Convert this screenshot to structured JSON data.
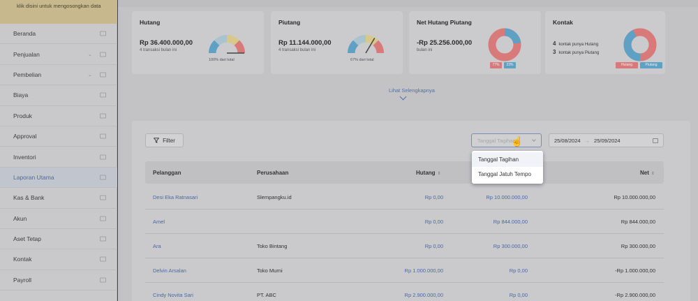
{
  "sidebar": {
    "notice": "klik disini untuk mengosongkan data",
    "items": [
      {
        "label": "Beranda",
        "chev": false
      },
      {
        "label": "Penjualan",
        "chev": true
      },
      {
        "label": "Pembelian",
        "chev": true
      },
      {
        "label": "Biaya",
        "chev": false
      },
      {
        "label": "Produk",
        "chev": false
      },
      {
        "label": "Approval",
        "chev": false
      },
      {
        "label": "Inventori",
        "chev": false
      },
      {
        "label": "Laporan Utama",
        "chev": false,
        "active": true
      },
      {
        "label": "Kas & Bank",
        "chev": false
      },
      {
        "label": "Akun",
        "chev": false
      },
      {
        "label": "Aset Tetap",
        "chev": false
      },
      {
        "label": "Kontak",
        "chev": false
      },
      {
        "label": "Payroll",
        "chev": false
      }
    ]
  },
  "cards": {
    "hutang": {
      "title": "Hutang",
      "amount": "Rp 36.400.000,00",
      "sub": "4 transaksi bulan ini",
      "gauge_caption": "100% dari total",
      "gauge_fraction": 1.0
    },
    "piutang": {
      "title": "Piutang",
      "amount": "Rp 11.144.000,00",
      "sub": "4 transaksi bulan ini",
      "gauge_caption": "67% dari total",
      "gauge_fraction": 0.67
    },
    "net": {
      "title": "Net Hutang Piutang",
      "amount": "-Rp 25.256.000,00",
      "sub": "bulan ini",
      "tag_left": "77%",
      "tag_right": "23%"
    },
    "kontak": {
      "title": "Kontak",
      "hutang_count": "4",
      "hutang_label": "kontak punya Hutang",
      "piutang_count": "3",
      "piutang_label": "kontak punya Piutang",
      "tag_left": "Hutang",
      "tag_right": "Piutang"
    }
  },
  "colors": {
    "red": "#d97a7a",
    "blue": "#5fa1c4",
    "yellow": "#d8c88c",
    "link": "#4a68a5"
  },
  "more_link": "Lihat Selengkapnya",
  "toolbar": {
    "filter_label": "Filter",
    "select_placeholder": "Tanggal Tagihan",
    "date_start": "25/08/2024",
    "date_end": "25/09/2024"
  },
  "dropdown": {
    "options": [
      "Tanggal Tagihan",
      "Tanggal Jatuh Tempo"
    ]
  },
  "table": {
    "columns": {
      "pelanggan": "Pelanggan",
      "perusahaan": "Perusahaan",
      "hutang": "Hutang",
      "net": "Net"
    },
    "rows": [
      {
        "pelanggan": "Desi Eka Ratnasari",
        "perusahaan": "Slempangku.id",
        "hutang": "Rp 0,00",
        "piutang": "Rp 10.000.000,00",
        "net": "Rp 10.000.000,00"
      },
      {
        "pelanggan": "Amel",
        "perusahaan": "",
        "hutang": "Rp 0,00",
        "piutang": "Rp 844.000,00",
        "net": "Rp 844.000,00"
      },
      {
        "pelanggan": "Ara",
        "perusahaan": "Toko Bintang",
        "hutang": "Rp 0,00",
        "piutang": "Rp 300.000,00",
        "net": "Rp 300.000,00"
      },
      {
        "pelanggan": "Delvin Arsalan",
        "perusahaan": "Toko Murni",
        "hutang": "Rp 1.000.000,00",
        "piutang": "Rp 0,00",
        "net": "-Rp 1.000.000,00"
      },
      {
        "pelanggan": "Cindy Novita Sari",
        "perusahaan": "PT. ABC",
        "hutang": "Rp 2.900.000,00",
        "piutang": "Rp 0,00",
        "net": "-Rp 2.900.000,00"
      }
    ]
  }
}
